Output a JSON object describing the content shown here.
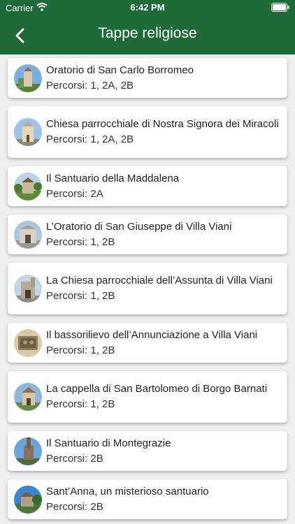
{
  "status": {
    "carrier": "Carrier",
    "time": "6:42 PM"
  },
  "header": {
    "title": "Tappe religiose"
  },
  "items": [
    {
      "name": "Oratorio di San Carlo Borromeo",
      "routes": "Percorsi: 1, 2A, 2B"
    },
    {
      "name": "Chiesa parrocchiale di Nostra Signora dei Miracoli",
      "routes": "Percorsi: 1, 2A, 2B"
    },
    {
      "name": "Il Santuario della Maddalena",
      "routes": "Percorsi: 2A"
    },
    {
      "name": "L’Oratorio di San Giuseppe di Villa Viani",
      "routes": "Percorsi: 1, 2B"
    },
    {
      "name": "La Chiesa parrocchiale dell’Assunta di Villa Viani",
      "routes": "Percorsi: 1, 2B"
    },
    {
      "name": "Il bassorilievo dell’Annunciazione a Villa Viani",
      "routes": "Percorsi: 1, 2B"
    },
    {
      "name": "La cappella di San Bartolomeo di Borgo Barnati",
      "routes": "Percorsi: 1, 2B"
    },
    {
      "name": "Il Santuario di Montegrazie",
      "routes": "Percorsi: 2B"
    },
    {
      "name": "Sant’Anna, un misterioso santuario",
      "routes": "Percorsi: 2B"
    }
  ]
}
